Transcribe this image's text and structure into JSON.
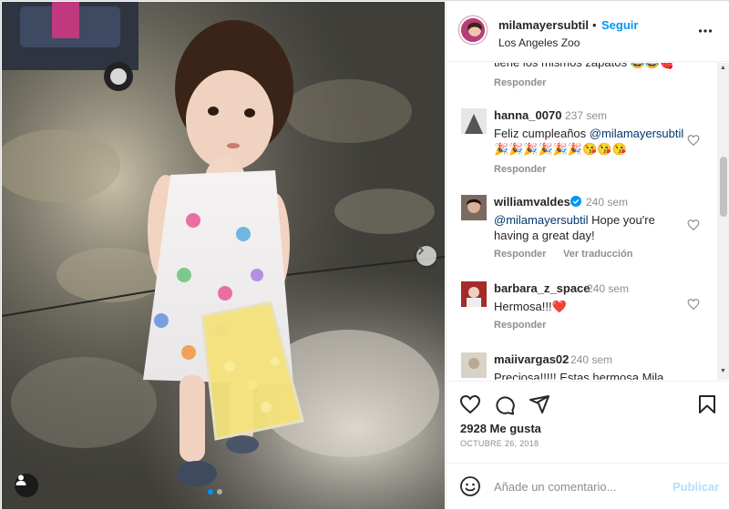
{
  "post": {
    "username": "milamayersubtil",
    "separator": "•",
    "follow_label": "Seguir",
    "location": "Los Angeles Zoo"
  },
  "comments": {
    "partial_text": "tiene los mismos zapatos 😂😂🍓",
    "partial_reply": "Responder",
    "items": [
      {
        "user": "hanna_0070",
        "time": "237 sem",
        "text_prefix": "Feliz cumpleaños ",
        "mention": "@milamayersubtil",
        "text_suffix": " 🎉🎉🎉🎉🎉🎉😘😘😘",
        "reply": "Responder",
        "verified": false,
        "avatar_color": "#5a5a5a"
      },
      {
        "user": "williamvaldes",
        "time": "240 sem",
        "text_prefix": "",
        "mention": "@milamayersubtil",
        "text_suffix": " Hope you're having a great day!",
        "reply": "Responder",
        "translate": "Ver traducción",
        "verified": true,
        "avatar_color": "#3c2f2a"
      },
      {
        "user": "barbara_z_space",
        "time": "240 sem",
        "text_prefix": "Hermosa!!!",
        "mention": "",
        "text_suffix": "❤️",
        "reply": "Responder",
        "verified": false,
        "avatar_color": "#b8332e"
      },
      {
        "user": "maiivargas02",
        "time": "240 sem",
        "text_prefix": "Preciosa!!!!! Estas hermosa Mila",
        "mention": "",
        "text_suffix": "",
        "verified": false,
        "avatar_color": "#cfc8bd"
      }
    ]
  },
  "stats": {
    "likes": "2928 Me gusta",
    "date": "OCTUBRE 26, 2018"
  },
  "composer": {
    "placeholder": "Añade un comentario...",
    "publish_label": "Publicar"
  },
  "icons": {
    "heart": "heart-icon",
    "comment": "comment-icon",
    "share": "share-icon",
    "save": "bookmark-icon",
    "more": "more-icon",
    "emoji": "emoji-icon",
    "tag": "user-tag-icon",
    "next": "chevron-right-icon"
  },
  "colors": {
    "accent": "#0095f6",
    "publish_disabled": "#b2dffc",
    "muted": "#8e8e8e"
  }
}
